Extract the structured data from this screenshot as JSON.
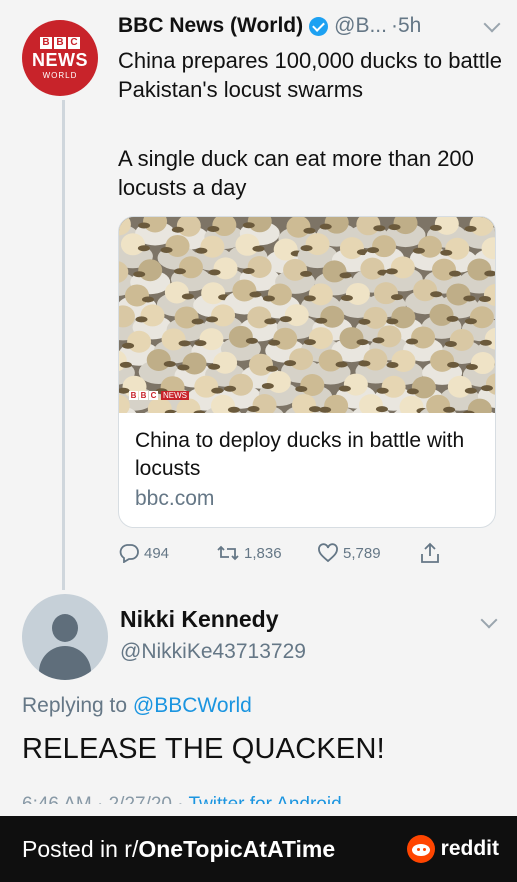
{
  "tweet": {
    "avatar": {
      "brand_blocks": [
        "B",
        "B",
        "C"
      ],
      "brand_line": "NEWS",
      "sub_line": "WORLD"
    },
    "author_name": "BBC News (World)",
    "handle": "@B...",
    "time": "·5h",
    "text": "China prepares 100,000 ducks to battle Pakistan's locust swarms",
    "subtext": "A single duck can eat more than 200 locusts a day",
    "link_card": {
      "image_description": "ducks",
      "watermark_blocks": [
        "B",
        "B",
        "C"
      ],
      "watermark_text": "NEWS",
      "title": "China to deploy ducks in battle with locusts",
      "domain": "bbc.com"
    },
    "actions": {
      "replies": "494",
      "retweets": "1,836",
      "likes": "5,789"
    }
  },
  "reply": {
    "author_name": "Nikki Kennedy",
    "handle": "@NikkiKe43713729",
    "replying_prefix": "Replying to",
    "replying_to": "@BBCWorld",
    "text": "RELEASE THE QUACKEN!",
    "meta_time": "6:46 AM · 2/27/20 ·",
    "meta_via": "Twitter for Android"
  },
  "footer": {
    "prefix": "Posted in r/",
    "subreddit": "OneTopicAtATime",
    "brand": "reddit"
  },
  "colors": {
    "bbc_red": "#c8232a",
    "twitter_blue": "#1da1f2",
    "muted_gray": "#657786",
    "reddit_orange": "#ff4500"
  }
}
